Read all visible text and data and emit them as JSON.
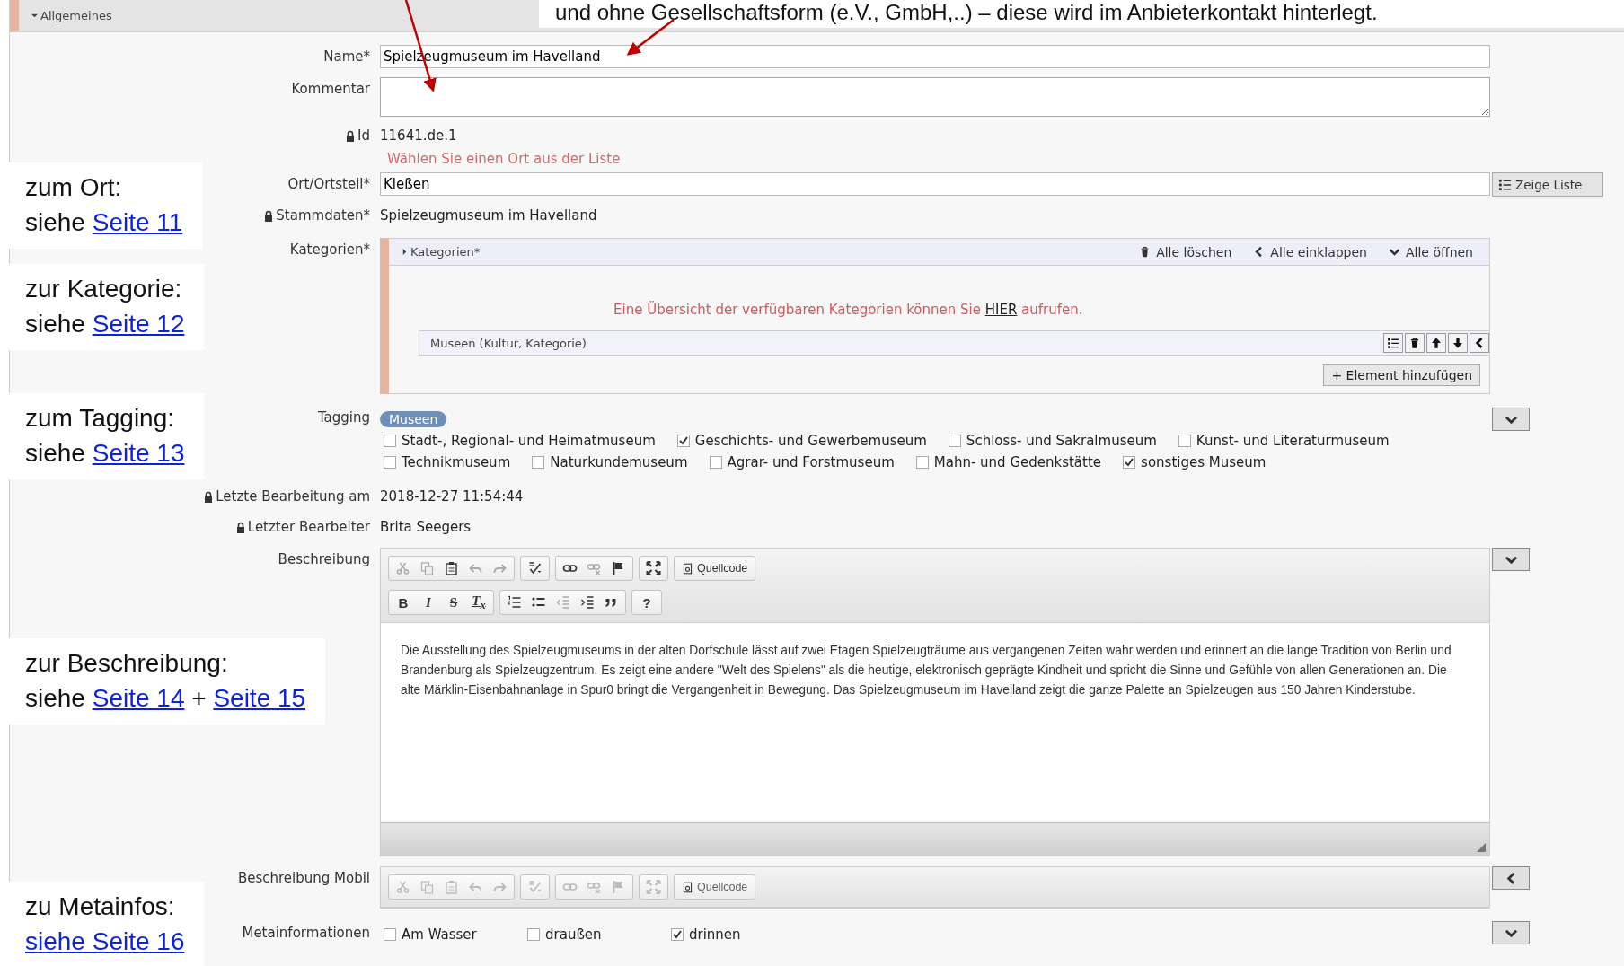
{
  "top_note": "und ohne Gesellschaftsform (e.V., GmbH,..) – diese wird im Anbieterkontakt hinterlegt.",
  "section": {
    "title": "Allgemeines",
    "expanded": true
  },
  "name": {
    "label": "Name*",
    "value": "Spielzeugmuseum im Havelland"
  },
  "kommentar": {
    "label": "Kommentar"
  },
  "id": {
    "label": "Id",
    "value": "11641.de.1",
    "locked": true
  },
  "ort": {
    "hint": "Wählen Sie einen Ort aus der Liste",
    "label": "Ort/Ortsteil*",
    "value": "Kleßen",
    "button": "Zeige Liste"
  },
  "stammdaten": {
    "label": "Stammdaten*",
    "value": "Spielzeugmuseum im Havelland",
    "locked": true
  },
  "kategorien": {
    "label": "Kategorien*",
    "panel_title": "Kategorien*",
    "expanded": false,
    "actions": [
      {
        "kind": "delete",
        "label": "Alle löschen"
      },
      {
        "kind": "collapse",
        "label": "Alle einklappen"
      },
      {
        "kind": "expand",
        "label": "Alle öffnen"
      }
    ],
    "notice_before": "Eine Übersicht der verfügbaren Kategorien können Sie ",
    "notice_link": "HIER",
    "notice_after": " aufrufen.",
    "item": "Museen (Kultur, Kategorie)",
    "add_button": "+ Element hinzufügen"
  },
  "tagging": {
    "label": "Tagging",
    "tag": "Museen",
    "expanded": true,
    "option_rows": [
      [
        {
          "label": "Stadt-, Regional- und Heimatmuseum",
          "checked": false
        },
        {
          "label": "Geschichts- und Gewerbemuseum",
          "checked": true
        },
        {
          "label": "Schloss- und Sakralmuseum",
          "checked": false
        },
        {
          "label": "Kunst- und Literaturmuseum",
          "checked": false
        }
      ],
      [
        {
          "label": "Technikmuseum",
          "checked": false
        },
        {
          "label": "Naturkundemuseum",
          "checked": false
        },
        {
          "label": "Agrar- und Forstmuseum",
          "checked": false
        },
        {
          "label": "Mahn- und Gedenkstätte",
          "checked": false
        },
        {
          "label": "sonstiges Museum",
          "checked": true
        }
      ]
    ]
  },
  "letzte_bearbeitung": {
    "label": "Letzte Bearbeitung am",
    "value": "2018-12-27 11:54:44",
    "locked": true
  },
  "letzter_bearbeiter": {
    "label": "Letzter Bearbeiter",
    "value": "Brita Seegers",
    "locked": true
  },
  "beschreibung": {
    "label": "Beschreibung",
    "expanded": true,
    "disabled": false,
    "source_button": "Quellcode",
    "format_buttons": [
      {
        "kind": "bold",
        "label": "B"
      },
      {
        "kind": "italic",
        "label": "I"
      },
      {
        "kind": "strike",
        "label": "S"
      },
      {
        "kind": "clear",
        "label": "T$_{x}$"
      }
    ],
    "help_button": "?",
    "text": "Die Ausstellung des Spielzeugmuseums in der alten Dorfschule lässt auf zwei Etagen Spielzeugträume aus vergangenen Zeiten wahr werden und erinnert an die lange Tradition von Berlin und Brandenburg als Spielzeugzentrum. Es zeigt eine andere \"Welt des Spielens\" als die heutige, elektronisch geprägte Kindheit und spricht die Sinne und Gefühle von allen Generationen an. Die alte Märklin-Eisenbahnanlage in Spur0 bringt die Vergangenheit in Bewegung. Das Spielzeugmuseum im Havelland zeigt die ganze Palette an Spielzeugen aus 150 Jahren Kinderstube."
  },
  "beschreibung_mobil": {
    "label": "Beschreibung Mobil",
    "expanded": false,
    "disabled": true,
    "source_button": "Quellcode"
  },
  "metainformationen": {
    "label": "Metainformationen",
    "expanded": true,
    "options": [
      {
        "label": "Am Wasser",
        "checked": false
      },
      {
        "label": "draußen",
        "checked": false
      },
      {
        "label": "drinnen",
        "checked": true
      }
    ]
  },
  "notes": [
    {
      "title": "zum Ort:",
      "parts": [
        {
          "kind": "text",
          "text": "siehe "
        },
        {
          "kind": "link",
          "text": "Seite 11"
        }
      ]
    },
    {
      "title": "zur Kategorie:",
      "parts": [
        {
          "kind": "text",
          "text": "siehe "
        },
        {
          "kind": "link",
          "text": "Seite 12"
        }
      ]
    },
    {
      "title": "zum Tagging:",
      "parts": [
        {
          "kind": "text",
          "text": "siehe "
        },
        {
          "kind": "link",
          "text": "Seite 13"
        }
      ]
    },
    {
      "title": "zur Beschreibung:",
      "parts": [
        {
          "kind": "text",
          "text": "siehe "
        },
        {
          "kind": "link",
          "text": "Seite 14"
        },
        {
          "kind": "text",
          "text": " + "
        },
        {
          "kind": "link",
          "text": "Seite 15"
        }
      ]
    },
    {
      "title": "zu Metainfos:",
      "parts": [
        {
          "kind": "link",
          "text": "siehe Seite 16"
        }
      ]
    }
  ]
}
